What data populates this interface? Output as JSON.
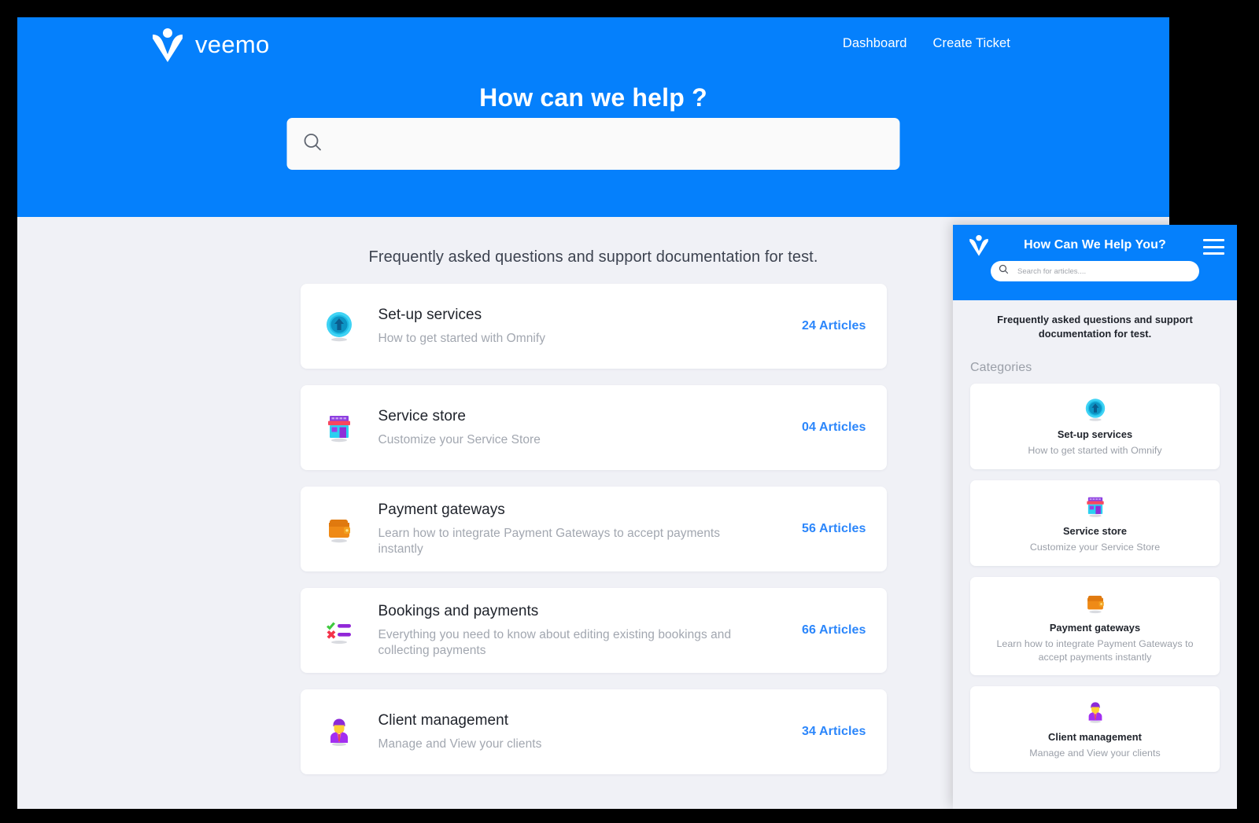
{
  "colors": {
    "brand_blue": "#0580fc",
    "page_bg": "#f0f1f6",
    "card_bg": "#ffffff",
    "count_blue": "#2b86fb",
    "muted_text": "#a2a7b0",
    "title_text": "#20242c",
    "outer_bg": "#000000"
  },
  "desktop": {
    "brand": {
      "name": "veemo",
      "logo_icon": "veemo-v-person-logo"
    },
    "nav": [
      {
        "label": "Dashboard"
      },
      {
        "label": "Create Ticket"
      }
    ],
    "hero": {
      "title": "How can we help ?"
    },
    "search": {
      "icon": "search-icon",
      "value": "",
      "placeholder": ""
    },
    "subtitle": "Frequently asked questions and support documentation for test.",
    "categories": [
      {
        "icon": "upload-circle-icon",
        "title": "Set-up services",
        "description": "How to get started with Omnify",
        "count": "24 Articles"
      },
      {
        "icon": "storefront-icon",
        "title": "Service store",
        "description": "Customize your Service Store",
        "count": "04 Articles"
      },
      {
        "icon": "wallet-icon",
        "title": "Payment gateways",
        "description": "Learn how to integrate Payment Gateways to accept payments instantly",
        "count": "56 Articles"
      },
      {
        "icon": "checklist-icon",
        "title": "Bookings and payments",
        "description": "Everything you need to know about editing existing bookings and collecting payments",
        "count": "66 Articles"
      },
      {
        "icon": "user-person-icon",
        "title": "Client management",
        "description": "Manage and View your clients",
        "count": "34 Articles"
      }
    ]
  },
  "mobile": {
    "logo_icon": "veemo-v-person-logo",
    "title": "How Can We Help You?",
    "menu_icon": "hamburger-menu-icon",
    "search": {
      "icon": "search-icon",
      "value": "",
      "placeholder": "Search for articles...."
    },
    "subtitle": "Frequently asked questions and support documentation for test.",
    "section_label": "Categories",
    "categories": [
      {
        "icon": "upload-circle-icon",
        "title": "Set-up services",
        "description": "How to get started with Omnify"
      },
      {
        "icon": "storefront-icon",
        "title": "Service store",
        "description": "Customize your Service Store"
      },
      {
        "icon": "wallet-icon",
        "title": "Payment gateways",
        "description": "Learn how to integrate Payment Gateways to accept payments instantly"
      },
      {
        "icon": "user-person-icon",
        "title": "Client management",
        "description": "Manage and View your clients"
      }
    ]
  }
}
